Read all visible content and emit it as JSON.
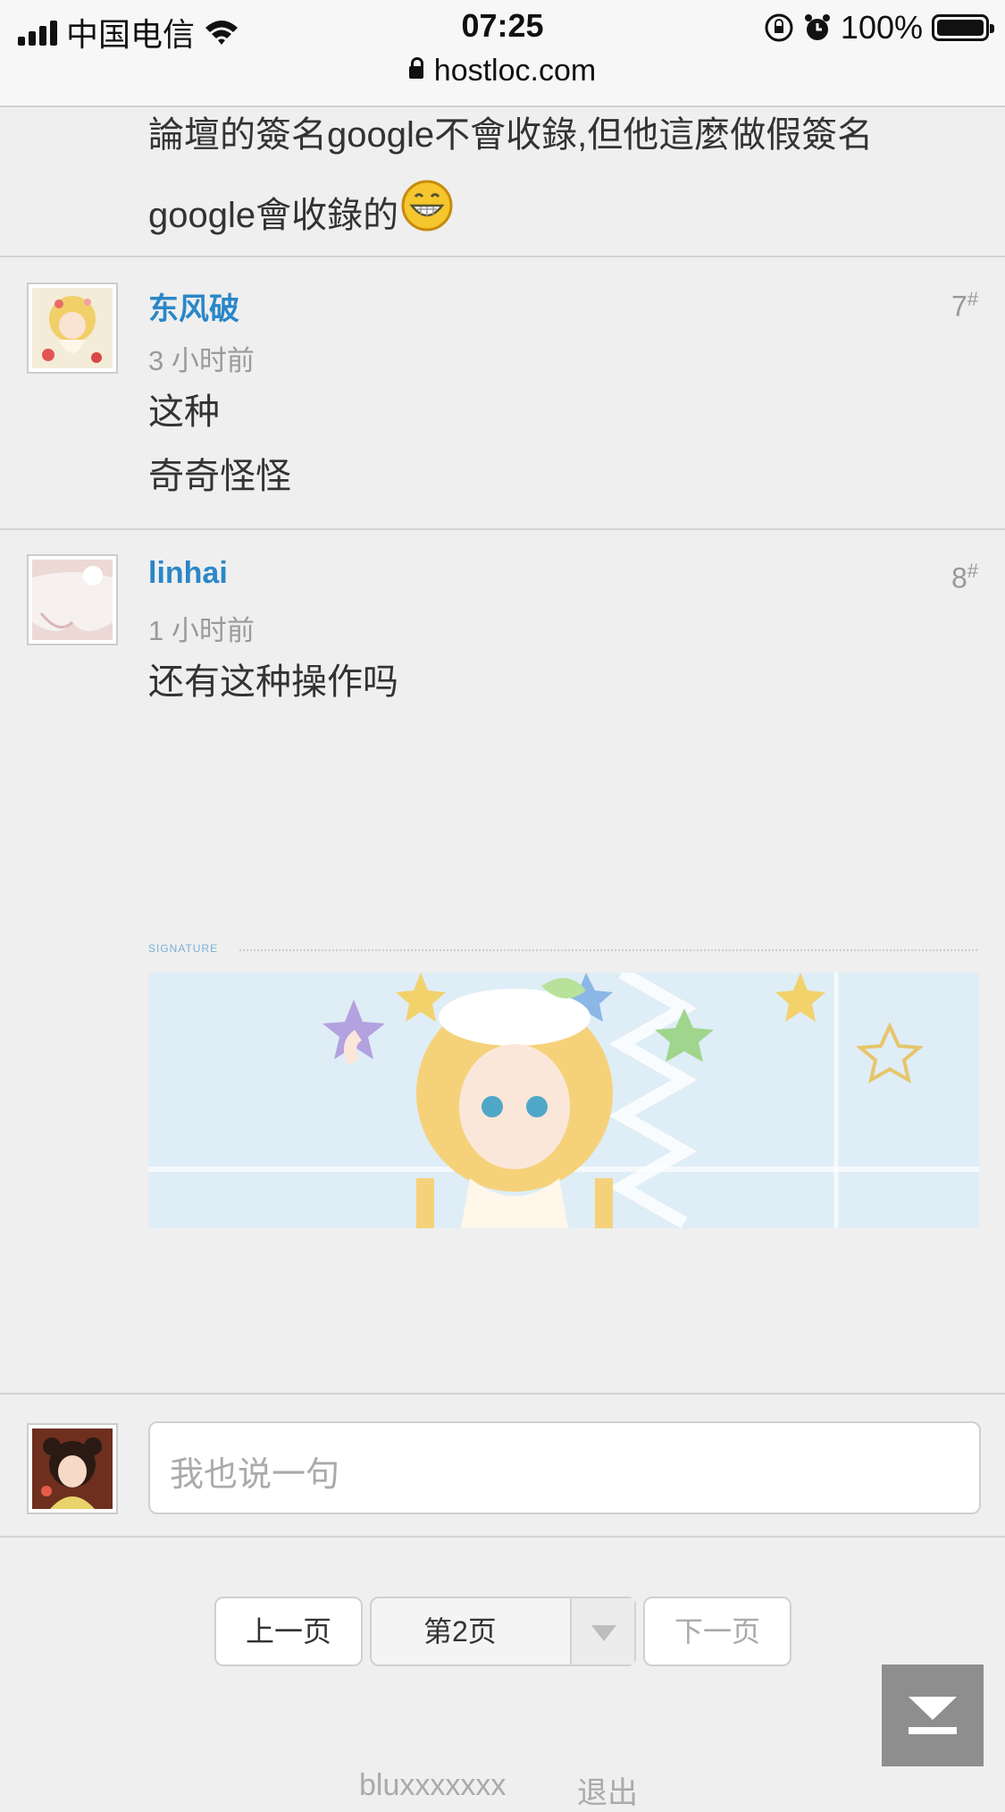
{
  "status_bar": {
    "carrier": "中国电信",
    "time": "07:25",
    "battery": "100%",
    "url": "hostloc.com"
  },
  "prev_post": {
    "line1": "論壇的簽名google不會收錄,但他這麼做假簽名",
    "line2": "google會收錄的"
  },
  "posts": [
    {
      "username": "东风破",
      "time": "3 小时前",
      "floor": "7",
      "content": [
        "这种",
        "奇奇怪怪"
      ]
    },
    {
      "username": "linhai",
      "time": "1 小时前",
      "floor": "8",
      "content": [
        "还有这种操作吗"
      ],
      "signature_label": "SIGNATURE"
    }
  ],
  "floor_mark": "#",
  "reply": {
    "placeholder": "我也说一句"
  },
  "pagination": {
    "prev": "上一页",
    "current": "第2页",
    "next": "下一页"
  },
  "footer": {
    "user": "bluxxxxxxx",
    "logout": "退出"
  },
  "colors": {
    "username": "#2a87c8",
    "background": "#efefef"
  }
}
